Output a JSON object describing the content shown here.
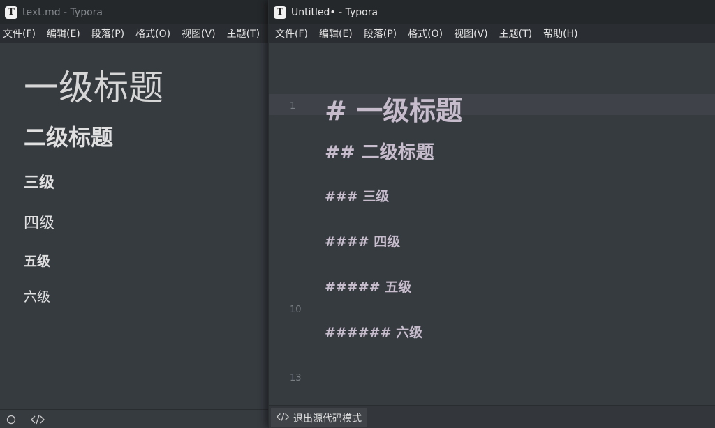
{
  "left_window": {
    "title": "text.md - Typora",
    "app_icon_letter": "T",
    "menu": [
      "文件(F)",
      "编辑(E)",
      "段落(P)",
      "格式(O)",
      "视图(V)",
      "主题(T)"
    ],
    "content": {
      "h1": "一级标题",
      "h2": "二级标题",
      "h3": "三级",
      "h4": "四级",
      "h5": "五级",
      "h6": "六级"
    },
    "status_icons": [
      "circle-icon",
      "code-icon"
    ]
  },
  "right_window": {
    "title": "Untitled• - Typora",
    "app_icon_letter": "T",
    "menu": [
      "文件(F)",
      "编辑(E)",
      "段落(P)",
      "格式(O)",
      "视图(V)",
      "主题(T)",
      "帮助(H)"
    ],
    "source_lines": {
      "h1": "# 一级标题",
      "h2": "## 二级标题",
      "h3": "### 三级",
      "h4": "#### 四级",
      "h5": "##### 五级",
      "h6": "###### 六级"
    },
    "line_numbers": [
      "1",
      "10",
      "13"
    ],
    "status": {
      "exit_source_label": "退出源代码模式",
      "icon": "code-icon"
    }
  },
  "colors": {
    "editor_bg": "#363b40",
    "titlebar_bg": "#25282b",
    "source_text": "#c7bccc",
    "active_line": "#3f4349"
  }
}
